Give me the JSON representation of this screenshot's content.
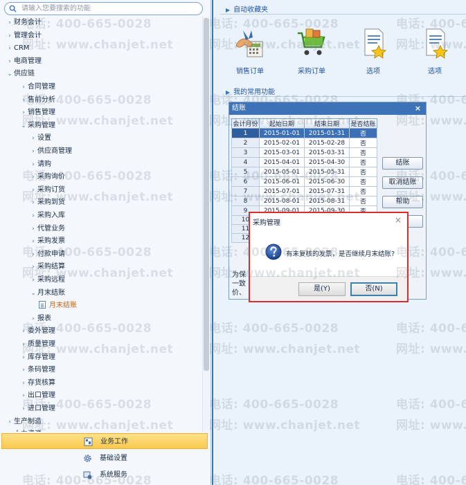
{
  "search": {
    "placeholder": "请输入您要搜索的功能"
  },
  "tree": [
    {
      "label": "财务会计",
      "level": 0,
      "state": "closed"
    },
    {
      "label": "管理会计",
      "level": 0,
      "state": "closed"
    },
    {
      "label": "CRM",
      "level": 0,
      "state": "closed"
    },
    {
      "label": "电商管理",
      "level": 0,
      "state": "closed"
    },
    {
      "label": "供应链",
      "level": 0,
      "state": "open"
    },
    {
      "label": "合同管理",
      "level": 1,
      "state": "closed"
    },
    {
      "label": "售前分析",
      "level": 1,
      "state": "closed"
    },
    {
      "label": "销售管理",
      "level": 1,
      "state": "closed"
    },
    {
      "label": "采购管理",
      "level": 1,
      "state": "open"
    },
    {
      "label": "设置",
      "level": 2,
      "state": "closed"
    },
    {
      "label": "供应商管理",
      "level": 2,
      "state": "closed"
    },
    {
      "label": "请购",
      "level": 2,
      "state": "closed"
    },
    {
      "label": "采购询价",
      "level": 2,
      "state": "closed"
    },
    {
      "label": "采购订货",
      "level": 2,
      "state": "closed"
    },
    {
      "label": "采购到货",
      "level": 2,
      "state": "closed"
    },
    {
      "label": "采购入库",
      "level": 2,
      "state": "closed"
    },
    {
      "label": "代管业务",
      "level": 2,
      "state": "closed"
    },
    {
      "label": "采购发票",
      "level": 2,
      "state": "closed"
    },
    {
      "label": "付款申请",
      "level": 2,
      "state": "closed"
    },
    {
      "label": "采购结算",
      "level": 2,
      "state": "closed"
    },
    {
      "label": "采购远程",
      "level": 2,
      "state": "closed"
    },
    {
      "label": "月末结账",
      "level": 2,
      "state": "open"
    },
    {
      "label": "月末结账",
      "level": 3,
      "state": "leaf"
    },
    {
      "label": "报表",
      "level": 2,
      "state": "closed"
    },
    {
      "label": "委外管理",
      "level": 1,
      "state": "closed"
    },
    {
      "label": "质量管理",
      "level": 1,
      "state": "closed"
    },
    {
      "label": "库存管理",
      "level": 1,
      "state": "closed"
    },
    {
      "label": "条码管理",
      "level": 1,
      "state": "closed"
    },
    {
      "label": "存货核算",
      "level": 1,
      "state": "closed"
    },
    {
      "label": "出口管理",
      "level": 1,
      "state": "closed"
    },
    {
      "label": "进口管理",
      "level": 1,
      "state": "closed"
    },
    {
      "label": "生产制造",
      "level": 0,
      "state": "closed"
    },
    {
      "label": "人力资源",
      "level": 0,
      "state": "closed"
    }
  ],
  "bottom_nav": [
    {
      "label": "业务工作",
      "icon": "business-icon",
      "active": true
    },
    {
      "label": "基础设置",
      "icon": "settings-gear-icon",
      "active": false
    },
    {
      "label": "系统服务",
      "icon": "system-service-icon",
      "active": false
    }
  ],
  "favorites": {
    "title": "自动收藏夹",
    "items": [
      {
        "label": "销售订单",
        "icon": "sales-order-icon"
      },
      {
        "label": "采购订单",
        "icon": "purchase-order-icon"
      },
      {
        "label": "选项",
        "icon": "options-doc-icon"
      },
      {
        "label": "选项",
        "icon": "options-doc-icon"
      }
    ]
  },
  "common": {
    "title": "我的常用功能"
  },
  "closing_dialog": {
    "title": "结账",
    "close": "×",
    "columns": [
      "会计月份",
      "起始日期",
      "结束日期",
      "是否结账"
    ],
    "rows": [
      [
        "1",
        "2015-01-01",
        "2015-01-31",
        "否"
      ],
      [
        "2",
        "2015-02-01",
        "2015-02-28",
        "否"
      ],
      [
        "3",
        "2015-03-01",
        "2015-03-31",
        "否"
      ],
      [
        "4",
        "2015-04-01",
        "2015-04-30",
        "否"
      ],
      [
        "5",
        "2015-05-01",
        "2015-05-31",
        "否"
      ],
      [
        "6",
        "2015-06-01",
        "2015-06-30",
        "否"
      ],
      [
        "7",
        "2015-07-01",
        "2015-07-31",
        "否"
      ],
      [
        "8",
        "2015-08-01",
        "2015-08-31",
        "否"
      ],
      [
        "9",
        "2015-09-01",
        "2015-09-30",
        "否"
      ],
      [
        "10",
        "",
        "",
        ""
      ],
      [
        "11",
        "",
        "",
        ""
      ],
      [
        "12",
        "",
        "",
        ""
      ]
    ],
    "selected_row": 0,
    "buttons": {
      "close_account": "结账",
      "cancel_close": "取消结账",
      "help": "帮助"
    },
    "note": "为保                                                数据\n一致                                                  单\n价、"
  },
  "message_box": {
    "title": "采购管理",
    "close": "×",
    "text": "有未复核的发票，是否继续月末结账?",
    "yes": "是(Y)",
    "no": "否(N)"
  },
  "watermark": {
    "phone": "电话: 400-665-0028",
    "site": "网址: www.chanjet.net"
  },
  "colors": {
    "accent": "#3c72b7",
    "highlight": "#e02a2a",
    "active_nav": "#f8c94b"
  }
}
